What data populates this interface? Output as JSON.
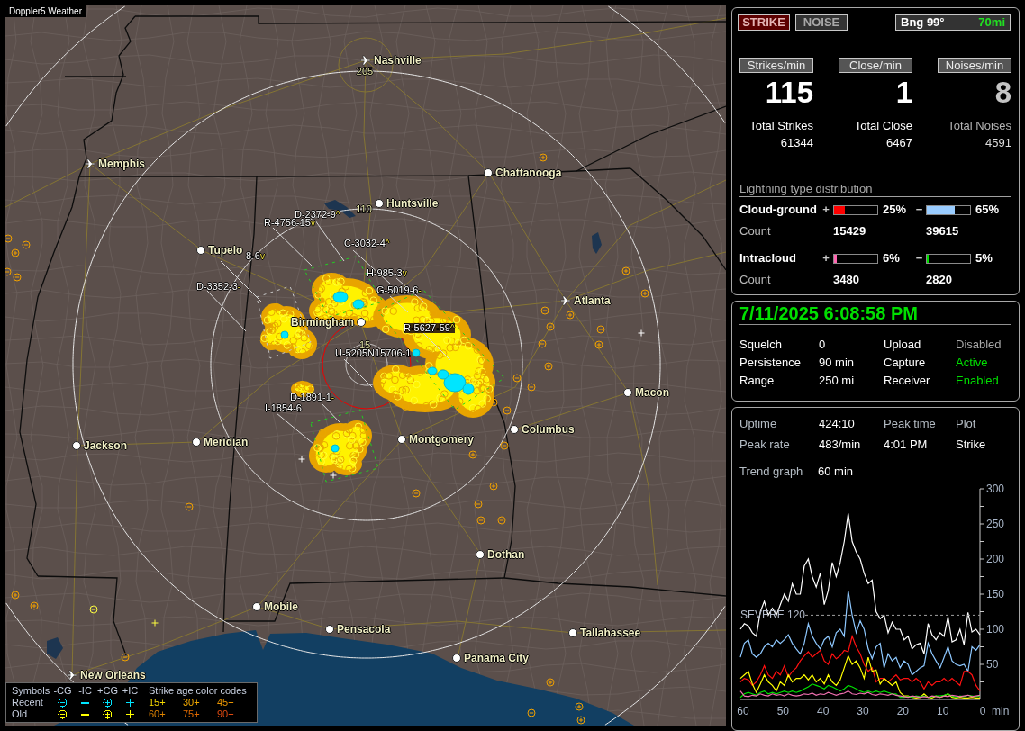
{
  "map": {
    "title": "Doppler5 Weather",
    "cities": [
      {
        "name": "Nashville",
        "kind": "airport"
      },
      {
        "name": "Memphis",
        "kind": "airport"
      },
      {
        "name": "Chattanooga",
        "kind": "city"
      },
      {
        "name": "Huntsville",
        "kind": "city"
      },
      {
        "name": "Tupelo",
        "kind": "city"
      },
      {
        "name": "Atlanta",
        "kind": "airport"
      },
      {
        "name": "Birmingham",
        "kind": "city"
      },
      {
        "name": "Macon",
        "kind": "city"
      },
      {
        "name": "Columbus",
        "kind": "city"
      },
      {
        "name": "Jackson",
        "kind": "city"
      },
      {
        "name": "Meridian",
        "kind": "city"
      },
      {
        "name": "Montgomery",
        "kind": "city"
      },
      {
        "name": "Dothan",
        "kind": "city"
      },
      {
        "name": "Mobile",
        "kind": "city"
      },
      {
        "name": "Pensacola",
        "kind": "city"
      },
      {
        "name": "Tallahassee",
        "kind": "city"
      },
      {
        "name": "Panama City",
        "kind": "city"
      },
      {
        "name": "New Orleans",
        "kind": "airport"
      }
    ],
    "range_labels": [
      "205",
      "110",
      "15"
    ],
    "storm_cells": [
      {
        "id": "D-2372-9",
        "trend": "^"
      },
      {
        "id": "R-4756-15",
        "trend": "v"
      },
      {
        "id": "C-3032-4",
        "trend": "^"
      },
      {
        "id": "8-6",
        "trend": "v"
      },
      {
        "id": "H-985-3",
        "trend": "v"
      },
      {
        "id": "D-3352-3",
        "trend": "-"
      },
      {
        "id": "G-5019-6",
        "trend": "-"
      },
      {
        "id": "R-5627-59",
        "trend": "^"
      },
      {
        "id": "U-5205N15706-1"
      },
      {
        "id": "D-1891-1",
        "trend": "-"
      },
      {
        "id": "I-1854-6"
      }
    ],
    "legend": {
      "header": "Symbols",
      "columns": [
        {
          "label": "-CG",
          "kind": "ringminus"
        },
        {
          "label": "-IC",
          "kind": "minus"
        },
        {
          "label": "+CG",
          "kind": "ringplus"
        },
        {
          "label": "+IC",
          "kind": "plus"
        }
      ],
      "rows": [
        {
          "label": "Recent",
          "color": "#00e5ff"
        },
        {
          "label": "Old",
          "color": "#ffff00"
        }
      ],
      "age_title": "Strike age color codes",
      "ages": [
        {
          "label": "15+",
          "color": "#f5d800"
        },
        {
          "label": "30+",
          "color": "#f0a800"
        },
        {
          "label": "45+",
          "color": "#e89400"
        },
        {
          "label": "60+",
          "color": "#e08400"
        },
        {
          "label": "75+",
          "color": "#e06a00"
        },
        {
          "label": "90+",
          "color": "#e04a10"
        }
      ]
    }
  },
  "mode_buttons": [
    {
      "label": "STRIKE",
      "selected": true
    },
    {
      "label": "NOISE",
      "selected": false
    }
  ],
  "bearing": {
    "label": "Bng 99°",
    "distance": "70mi"
  },
  "rates": [
    {
      "label": "Strikes/min",
      "value": "115",
      "total_label": "Total Strikes",
      "total": "61344",
      "dimmed": false
    },
    {
      "label": "Close/min",
      "value": "1",
      "total_label": "Total Close",
      "total": "6467",
      "dimmed": false
    },
    {
      "label": "Noises/min",
      "value": "8",
      "total_label": "Total Noises",
      "total": "4591",
      "dimmed": true
    }
  ],
  "distribution": {
    "title": "Lightning type distribution",
    "rows": [
      {
        "name": "Cloud-ground",
        "count_label": "Count",
        "polarities": [
          {
            "sign": "+",
            "level": 0.25,
            "percent": "25%",
            "color": "#ff0000",
            "count": "15429"
          },
          {
            "sign": "−",
            "level": 0.65,
            "percent": "65%",
            "color": "#99ccff",
            "count": "39615"
          }
        ]
      },
      {
        "name": "Intracloud",
        "count_label": "Count",
        "polarities": [
          {
            "sign": "+",
            "level": 0.06,
            "percent": "6%",
            "color": "#ff66b0",
            "count": "3480"
          },
          {
            "sign": "−",
            "level": 0.05,
            "percent": "5%",
            "color": "#00dd00",
            "count": "2820"
          }
        ]
      }
    ]
  },
  "status": {
    "datetime": "7/11/2025 6:08:58 PM",
    "rows": [
      {
        "label": "Squelch",
        "value": "0",
        "status_label": "Upload",
        "status": "Disabled",
        "on": false
      },
      {
        "label": "Persistence",
        "value": "90 min",
        "status_label": "Capture",
        "status": "Active",
        "on": true
      },
      {
        "label": "Range",
        "value": "250 mi",
        "status_label": "Receiver",
        "status": "Enabled",
        "on": true
      }
    ]
  },
  "stats": {
    "items": [
      {
        "label": "Uptime",
        "value": "424:10"
      },
      {
        "label": "Peak rate",
        "value": "483/min"
      }
    ],
    "peak": {
      "label": "Peak time",
      "value": "4:01 PM"
    },
    "plot": {
      "label": "Plot",
      "value": "Strike"
    },
    "trend": {
      "label": "Trend graph",
      "value": "60 min"
    },
    "chart_data": {
      "type": "line",
      "xlabel": "min",
      "x": [
        60,
        59,
        58,
        57,
        56,
        55,
        54,
        53,
        52,
        51,
        50,
        49,
        48,
        47,
        46,
        45,
        44,
        43,
        42,
        41,
        40,
        39,
        38,
        37,
        36,
        35,
        34,
        33,
        32,
        31,
        30,
        29,
        28,
        27,
        26,
        25,
        24,
        23,
        22,
        21,
        20,
        19,
        18,
        17,
        16,
        15,
        14,
        13,
        12,
        11,
        10,
        9,
        8,
        7,
        6,
        5,
        4,
        3,
        2,
        1,
        0
      ],
      "xlim": [
        60,
        0
      ],
      "ylim": [
        0,
        300
      ],
      "xticks": [
        60,
        50,
        40,
        30,
        20,
        10,
        0
      ],
      "yticks": [
        50,
        100,
        150,
        200,
        250,
        300
      ],
      "series": [
        {
          "color": "#ffffff",
          "values": [
            100,
            108,
            105,
            95,
            90,
            125,
            140,
            120,
            130,
            120,
            135,
            150,
            140,
            165,
            150,
            150,
            190,
            200,
            175,
            160,
            180,
            135,
            155,
            195,
            175,
            195,
            225,
            265,
            225,
            210,
            200,
            180,
            165,
            170,
            125,
            115,
            120,
            95,
            110,
            100,
            100,
            85,
            90,
            72,
            78,
            80,
            65,
            108,
            92,
            85,
            95,
            90,
            118,
            82,
            85,
            100,
            78,
            124,
            96,
            100,
            92
          ]
        },
        {
          "color": "#8ec8ff",
          "values": [
            60,
            80,
            85,
            65,
            60,
            65,
            75,
            80,
            75,
            85,
            80,
            85,
            92,
            80,
            72,
            65,
            80,
            108,
            90,
            80,
            72,
            85,
            90,
            75,
            95,
            100,
            90,
            155,
            120,
            95,
            112,
            100,
            72,
            58,
            75,
            80,
            45,
            65,
            55,
            60,
            45,
            55,
            50,
            35,
            40,
            45,
            48,
            80,
            65,
            55,
            45,
            60,
            75,
            55,
            50,
            48,
            50,
            40,
            75,
            70,
            78
          ]
        },
        {
          "color": "#ff1010",
          "values": [
            25,
            30,
            28,
            20,
            25,
            35,
            48,
            35,
            30,
            40,
            35,
            48,
            32,
            40,
            45,
            55,
            62,
            68,
            60,
            65,
            70,
            55,
            50,
            65,
            58,
            62,
            70,
            68,
            90,
            75,
            65,
            50,
            40,
            45,
            25,
            30,
            30,
            25,
            30,
            35,
            28,
            30,
            30,
            25,
            30,
            25,
            15,
            25,
            20,
            25,
            25,
            30,
            25,
            30,
            25,
            20,
            40,
            40,
            35,
            20,
            12
          ]
        },
        {
          "color": "#ffff00",
          "values": [
            30,
            35,
            40,
            22,
            10,
            22,
            35,
            25,
            20,
            12,
            25,
            20,
            35,
            25,
            30,
            30,
            35,
            28,
            35,
            25,
            30,
            22,
            35,
            25,
            20,
            28,
            45,
            62,
            50,
            55,
            45,
            30,
            60,
            40,
            42,
            22,
            30,
            25,
            20,
            25,
            10,
            5,
            5,
            3,
            2,
            3,
            8,
            3,
            2,
            5,
            3,
            5,
            8,
            3,
            2,
            3,
            2,
            2,
            3,
            2,
            2
          ]
        },
        {
          "color": "#00e000",
          "values": [
            3,
            8,
            10,
            8,
            6,
            10,
            12,
            8,
            10,
            8,
            10,
            12,
            10,
            12,
            10,
            12,
            15,
            18,
            22,
            20,
            18,
            15,
            20,
            18,
            15,
            12,
            15,
            20,
            18,
            15,
            12,
            10,
            12,
            10,
            12,
            10,
            12,
            10,
            8,
            8,
            3,
            3,
            4,
            3,
            5,
            4,
            5,
            3,
            4,
            5,
            5,
            6,
            8,
            5,
            3,
            5,
            4,
            6,
            5,
            4,
            5
          ]
        },
        {
          "color": "#f070b0",
          "values": [
            12,
            5,
            4,
            6,
            5,
            8,
            6,
            5,
            8,
            6,
            7,
            5,
            8,
            6,
            5,
            6,
            8,
            7,
            9,
            6,
            8,
            7,
            10,
            8,
            6,
            8,
            9,
            12,
            8,
            7,
            9,
            8,
            10,
            7,
            6,
            8,
            7,
            6,
            8,
            6,
            5,
            4,
            3,
            5,
            4,
            3,
            4,
            3,
            5,
            4,
            3,
            5,
            4,
            6,
            5,
            4,
            5,
            6,
            4,
            5,
            6
          ]
        }
      ],
      "annotations": [
        {
          "text": "SEVERE 120",
          "y": 120
        }
      ]
    }
  }
}
